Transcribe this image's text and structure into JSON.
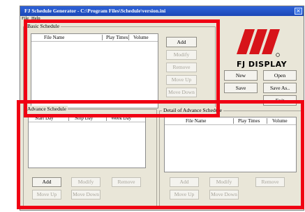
{
  "window": {
    "title": "FJ Schedule Generator - C:\\Program Files\\Schedule\\version.ini"
  },
  "menu": {
    "file": "File",
    "help": "Help"
  },
  "basic_schedule": {
    "label": "Basic Schedule",
    "columns": [
      "File Name",
      "Play Times",
      "Volume"
    ],
    "buttons": {
      "add": "Add",
      "modify": "Modify",
      "remove": "Remove",
      "move_up": "Move Up",
      "move_down": "Move Down"
    }
  },
  "logo": {
    "text": "FJ DISPLAY",
    "brand_color": "#d7141a"
  },
  "main_buttons": {
    "new": "New",
    "open": "Open",
    "save": "Save",
    "save_as": "Save As..",
    "exit": "Exit"
  },
  "advance_schedule": {
    "label": "Advance Schedule",
    "columns": [
      "Start Day",
      "Stop Day",
      "Week Day"
    ],
    "buttons": {
      "add": "Add",
      "modify": "Modify",
      "remove": "Remove",
      "move_up": "Move Up",
      "move_down": "Move Down"
    }
  },
  "detail_schedule": {
    "label": "Detail of Advance Schedule",
    "columns": [
      "File Name",
      "Play Times",
      "Volume"
    ],
    "buttons": {
      "add": "Add",
      "modify": "Modify",
      "remove": "Remove",
      "move_up": "Move Up",
      "move_down": "Move Down"
    }
  }
}
